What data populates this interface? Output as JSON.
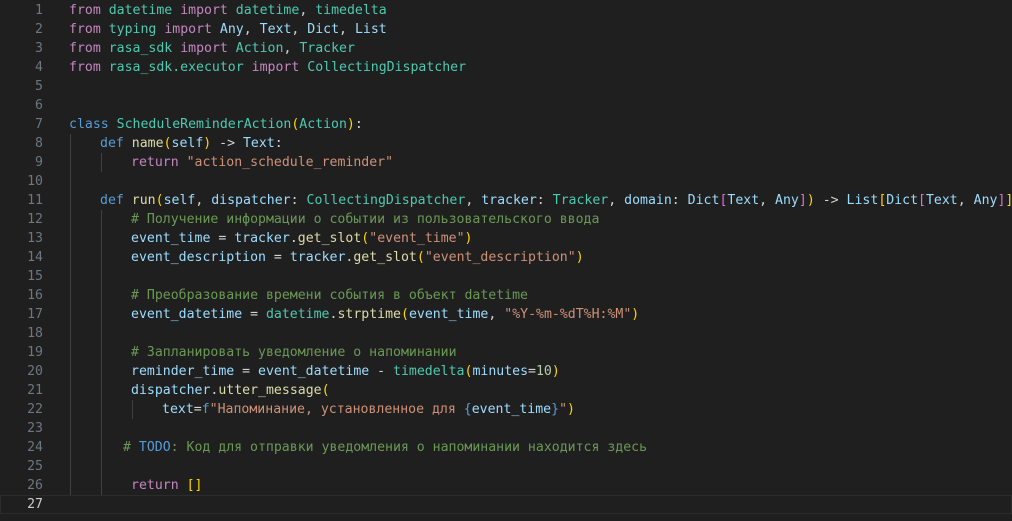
{
  "editor": {
    "language": "python",
    "current_line": 27,
    "lines": [
      {
        "n": "1",
        "indent": 0,
        "tokens": [
          [
            "kw",
            "from"
          ],
          [
            "p",
            " "
          ],
          [
            "mod",
            "datetime"
          ],
          [
            "p",
            " "
          ],
          [
            "kw",
            "import"
          ],
          [
            "p",
            " "
          ],
          [
            "cls",
            "datetime"
          ],
          [
            "p",
            ", "
          ],
          [
            "cls",
            "timedelta"
          ]
        ]
      },
      {
        "n": "2",
        "indent": 0,
        "tokens": [
          [
            "kw",
            "from"
          ],
          [
            "p",
            " "
          ],
          [
            "mod",
            "typing"
          ],
          [
            "p",
            " "
          ],
          [
            "kw",
            "import"
          ],
          [
            "p",
            " "
          ],
          [
            "var",
            "Any"
          ],
          [
            "p",
            ", "
          ],
          [
            "var",
            "Text"
          ],
          [
            "p",
            ", "
          ],
          [
            "var",
            "Dict"
          ],
          [
            "p",
            ", "
          ],
          [
            "var",
            "List"
          ]
        ]
      },
      {
        "n": "3",
        "indent": 0,
        "tokens": [
          [
            "kw",
            "from"
          ],
          [
            "p",
            " "
          ],
          [
            "mod",
            "rasa_sdk"
          ],
          [
            "p",
            " "
          ],
          [
            "kw",
            "import"
          ],
          [
            "p",
            " "
          ],
          [
            "cls",
            "Action"
          ],
          [
            "p",
            ", "
          ],
          [
            "cls",
            "Tracker"
          ]
        ]
      },
      {
        "n": "4",
        "indent": 0,
        "tokens": [
          [
            "kw",
            "from"
          ],
          [
            "p",
            " "
          ],
          [
            "mod",
            "rasa_sdk.executor"
          ],
          [
            "p",
            " "
          ],
          [
            "kw",
            "import"
          ],
          [
            "p",
            " "
          ],
          [
            "cls",
            "CollectingDispatcher"
          ]
        ]
      },
      {
        "n": "5",
        "indent": 0,
        "tokens": []
      },
      {
        "n": "6",
        "indent": 0,
        "tokens": []
      },
      {
        "n": "7",
        "indent": 0,
        "tokens": [
          [
            "decl",
            "class"
          ],
          [
            "p",
            " "
          ],
          [
            "cls",
            "ScheduleReminderAction"
          ],
          [
            "b1",
            "("
          ],
          [
            "cls",
            "Action"
          ],
          [
            "b1",
            ")"
          ],
          [
            "p",
            ":"
          ]
        ]
      },
      {
        "n": "8",
        "indent": 1,
        "tokens": [
          [
            "decl",
            "def"
          ],
          [
            "p",
            " "
          ],
          [
            "fn",
            "name"
          ],
          [
            "b1",
            "("
          ],
          [
            "var",
            "self"
          ],
          [
            "b1",
            ")"
          ],
          [
            "p",
            " -> "
          ],
          [
            "var",
            "Text"
          ],
          [
            "p",
            ":"
          ]
        ]
      },
      {
        "n": "9",
        "indent": 2,
        "tokens": [
          [
            "kw",
            "return"
          ],
          [
            "p",
            " "
          ],
          [
            "str",
            "\"action_schedule_reminder\""
          ]
        ]
      },
      {
        "n": "10",
        "indent": 1,
        "tokens": []
      },
      {
        "n": "11",
        "indent": 1,
        "tokens": [
          [
            "decl",
            "def"
          ],
          [
            "p",
            " "
          ],
          [
            "fn",
            "run"
          ],
          [
            "b1",
            "("
          ],
          [
            "var",
            "self"
          ],
          [
            "p",
            ", "
          ],
          [
            "var",
            "dispatcher"
          ],
          [
            "p",
            ": "
          ],
          [
            "cls",
            "CollectingDispatcher"
          ],
          [
            "p",
            ", "
          ],
          [
            "var",
            "tracker"
          ],
          [
            "p",
            ": "
          ],
          [
            "cls",
            "Tracker"
          ],
          [
            "p",
            ", "
          ],
          [
            "var",
            "domain"
          ],
          [
            "p",
            ": "
          ],
          [
            "var",
            "Dict"
          ],
          [
            "b2",
            "["
          ],
          [
            "var",
            "Text"
          ],
          [
            "p",
            ", "
          ],
          [
            "var",
            "Any"
          ],
          [
            "b2",
            "]"
          ],
          [
            "b1",
            ")"
          ],
          [
            "p",
            " -> "
          ],
          [
            "var",
            "List"
          ],
          [
            "b1",
            "["
          ],
          [
            "var",
            "Dict"
          ],
          [
            "b2",
            "["
          ],
          [
            "var",
            "Text"
          ],
          [
            "p",
            ", "
          ],
          [
            "var",
            "Any"
          ],
          [
            "b2",
            "]"
          ],
          [
            "b1",
            "]"
          ],
          [
            "p",
            ":"
          ]
        ]
      },
      {
        "n": "12",
        "indent": 2,
        "tokens": [
          [
            "cmt",
            "# Получение информации о событии из пользовательского ввода"
          ]
        ]
      },
      {
        "n": "13",
        "indent": 2,
        "tokens": [
          [
            "var",
            "event_time"
          ],
          [
            "p",
            " = "
          ],
          [
            "var",
            "tracker"
          ],
          [
            "p",
            "."
          ],
          [
            "fn",
            "get_slot"
          ],
          [
            "b1",
            "("
          ],
          [
            "str",
            "\"event_time\""
          ],
          [
            "b1",
            ")"
          ]
        ]
      },
      {
        "n": "14",
        "indent": 2,
        "tokens": [
          [
            "var",
            "event_description"
          ],
          [
            "p",
            " = "
          ],
          [
            "var",
            "tracker"
          ],
          [
            "p",
            "."
          ],
          [
            "fn",
            "get_slot"
          ],
          [
            "b1",
            "("
          ],
          [
            "str",
            "\"event_description\""
          ],
          [
            "b1",
            ")"
          ]
        ]
      },
      {
        "n": "15",
        "indent": 2,
        "tokens": []
      },
      {
        "n": "16",
        "indent": 2,
        "tokens": [
          [
            "cmt",
            "# Преобразование времени события в объект datetime"
          ]
        ]
      },
      {
        "n": "17",
        "indent": 2,
        "tokens": [
          [
            "var",
            "event_datetime"
          ],
          [
            "p",
            " = "
          ],
          [
            "cls",
            "datetime"
          ],
          [
            "p",
            "."
          ],
          [
            "fn",
            "strptime"
          ],
          [
            "b1",
            "("
          ],
          [
            "var",
            "event_time"
          ],
          [
            "p",
            ", "
          ],
          [
            "str",
            "\"%Y-%m-%dT%H:%M\""
          ],
          [
            "b1",
            ")"
          ]
        ]
      },
      {
        "n": "18",
        "indent": 2,
        "tokens": []
      },
      {
        "n": "19",
        "indent": 2,
        "tokens": [
          [
            "cmt",
            "# Запланировать уведомление о напоминании"
          ]
        ]
      },
      {
        "n": "20",
        "indent": 2,
        "tokens": [
          [
            "var",
            "reminder_time"
          ],
          [
            "p",
            " = "
          ],
          [
            "var",
            "event_datetime"
          ],
          [
            "p",
            " - "
          ],
          [
            "cls",
            "timedelta"
          ],
          [
            "b1",
            "("
          ],
          [
            "var",
            "minutes"
          ],
          [
            "p",
            "="
          ],
          [
            "num",
            "10"
          ],
          [
            "b1",
            ")"
          ]
        ]
      },
      {
        "n": "21",
        "indent": 2,
        "tokens": [
          [
            "var",
            "dispatcher"
          ],
          [
            "p",
            "."
          ],
          [
            "fn",
            "utter_message"
          ],
          [
            "b1",
            "("
          ]
        ]
      },
      {
        "n": "22",
        "indent": 3,
        "tokens": [
          [
            "var",
            "text"
          ],
          [
            "p",
            "="
          ],
          [
            "fstr",
            "f"
          ],
          [
            "str",
            "\"Напоминание, установленное для "
          ],
          [
            "decl",
            "{"
          ],
          [
            "var",
            "event_time"
          ],
          [
            "decl",
            "}"
          ],
          [
            "str",
            "\""
          ],
          [
            "b1",
            ")"
          ]
        ]
      },
      {
        "n": "23",
        "indent": 2,
        "tokens": []
      },
      {
        "n": "24",
        "indent": 2,
        "pad": -8,
        "tokens": [
          [
            "cmt",
            "# "
          ],
          [
            "todo",
            "TODO"
          ],
          [
            "cmt",
            ": Код для отправки уведомления о напоминании находится здесь"
          ]
        ]
      },
      {
        "n": "25",
        "indent": 2,
        "tokens": []
      },
      {
        "n": "26",
        "indent": 2,
        "tokens": [
          [
            "kw",
            "return"
          ],
          [
            "p",
            " "
          ],
          [
            "b1",
            "[]"
          ]
        ]
      },
      {
        "n": "27",
        "indent": 0,
        "tokens": []
      }
    ]
  }
}
